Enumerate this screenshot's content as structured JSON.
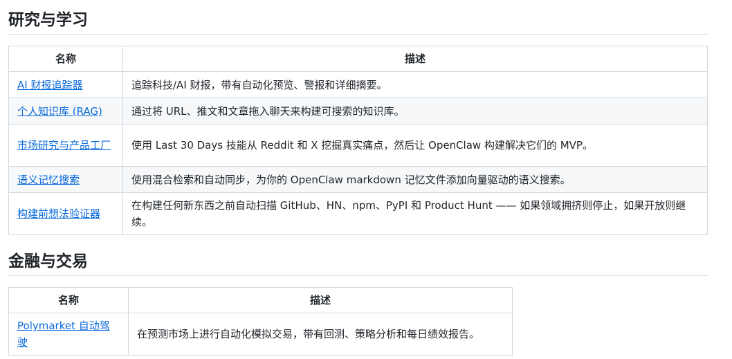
{
  "sections": [
    {
      "title": "研究与学习",
      "headers": [
        "名称",
        "描述"
      ],
      "rows": [
        {
          "name": "AI 财报追踪器",
          "desc": "追踪科技/AI 财报，带有自动化预览、警报和详细摘要。"
        },
        {
          "name": "个人知识库 (RAG)",
          "desc": "通过将 URL、推文和文章拖入聊天来构建可搜索的知识库。"
        },
        {
          "name": "市场研究与产品工厂",
          "desc": "使用 Last 30 Days 技能从 Reddit 和 X 挖掘真实痛点，然后让 OpenClaw 构建解决它们的 MVP。"
        },
        {
          "name": "语义记忆搜索",
          "desc": "使用混合检索和自动同步，为你的 OpenClaw markdown 记忆文件添加向量驱动的语义搜索。"
        },
        {
          "name": "构建前想法验证器",
          "desc": "在构建任何新东西之前自动扫描 GitHub、HN、npm、PyPI 和 Product Hunt —— 如果领域拥挤则停止，如果开放则继续。"
        }
      ]
    },
    {
      "title": "金融与交易",
      "headers": [
        "名称",
        "描述"
      ],
      "rows": [
        {
          "name": "Polymarket 自动驾驶",
          "desc": "在预测市场上进行自动化模拟交易，带有回测、策略分析和每日绩效报告。"
        }
      ]
    }
  ],
  "colors": {
    "link": "#0969da",
    "border": "#d0d7de",
    "alt_row": "#f6f8fa",
    "text": "#1f2328"
  }
}
